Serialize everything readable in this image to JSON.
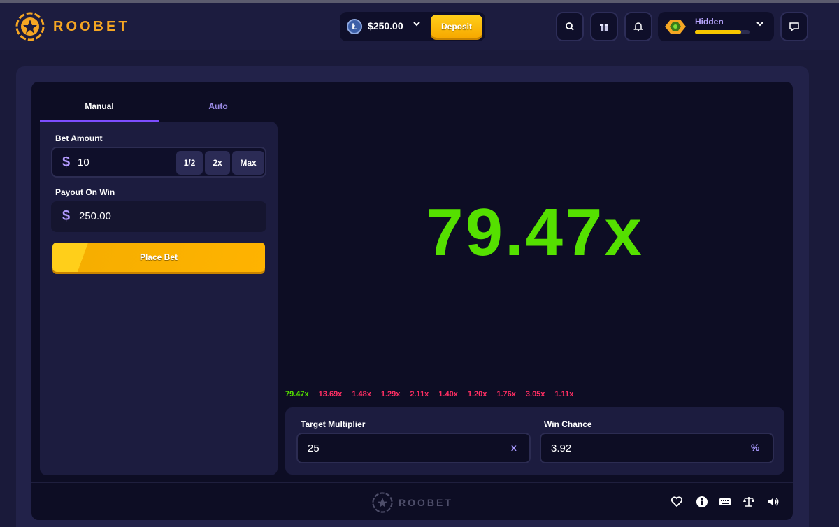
{
  "brand": {
    "name": "ROOBET"
  },
  "header": {
    "balance": "$250.00",
    "deposit_label": "Deposit",
    "user": {
      "name": "Hidden",
      "xp_progress_percent": 85
    }
  },
  "tabs": [
    {
      "label": "Manual",
      "active": true
    },
    {
      "label": "Auto",
      "active": false
    }
  ],
  "bet": {
    "amount_label": "Bet Amount",
    "currency_symbol": "$",
    "amount": "10",
    "half_label": "1/2",
    "double_label": "2x",
    "max_label": "Max",
    "payout_label": "Payout On Win",
    "payout": "250.00",
    "place_bet_label": "Place Bet"
  },
  "result": {
    "multiplier": "79.47x",
    "color": "#55e000"
  },
  "history": [
    {
      "value": "79.47x",
      "color": "#55e000"
    },
    {
      "value": "13.69x",
      "color": "#ff2e63"
    },
    {
      "value": "1.48x",
      "color": "#ff2e63"
    },
    {
      "value": "1.29x",
      "color": "#ff2e63"
    },
    {
      "value": "2.11x",
      "color": "#ff2e63"
    },
    {
      "value": "1.40x",
      "color": "#ff2e63"
    },
    {
      "value": "1.20x",
      "color": "#ff2e63"
    },
    {
      "value": "1.76x",
      "color": "#ff2e63"
    },
    {
      "value": "3.05x",
      "color": "#ff2e63"
    },
    {
      "value": "1.11x",
      "color": "#ff2e63"
    }
  ],
  "controls": {
    "target_label": "Target Multiplier",
    "target_value": "25",
    "target_suffix": "x",
    "chance_label": "Win Chance",
    "chance_value": "3.92",
    "chance_suffix": "%"
  },
  "footer": {
    "logo_text": "ROOBET",
    "icons": [
      "heart-icon",
      "info-icon",
      "keyboard-icon",
      "fairness-scale-icon",
      "volume-icon"
    ]
  },
  "colors": {
    "accent": "#7c4dff",
    "brand_yellow": "#ffb300",
    "win_green": "#55e000",
    "loss_red": "#ff2e63"
  }
}
